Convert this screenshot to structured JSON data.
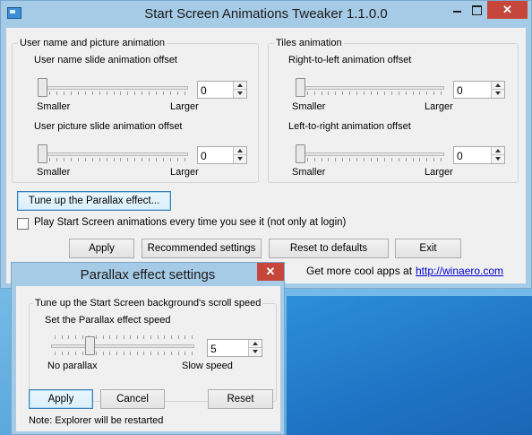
{
  "main_window": {
    "title": "Start Screen Animations Tweaker 1.1.0.0",
    "close_glyph": "✕",
    "user_group": {
      "legend": "User name and picture animation",
      "slide_label": "User name slide animation offset",
      "slide_value": "0",
      "picture_label": "User picture slide animation offset",
      "picture_value": "0",
      "min_label": "Smaller",
      "max_label": "Larger"
    },
    "tiles_group": {
      "legend": "Tiles animation",
      "rtl_label": "Right-to-left animation offset",
      "rtl_value": "0",
      "ltr_label": "Left-to-right animation offset",
      "ltr_value": "0",
      "min_label": "Smaller",
      "max_label": "Larger"
    },
    "parallax_button": "Tune up the Parallax effect...",
    "play_checkbox_label": "Play Start Screen animations every time you see it (not only at login)",
    "play_checkbox_checked": false,
    "buttons": {
      "apply": "Apply",
      "recommended": "Recommended settings",
      "reset_defaults": "Reset to defaults",
      "exit": "Exit"
    },
    "footer_text": "Get more cool apps at",
    "footer_link": "http://winaero.com"
  },
  "parallax_dialog": {
    "title": "Parallax effect settings",
    "close_glyph": "✕",
    "group_legend": "Tune up the Start Screen background's scroll speed",
    "speed_label": "Set the Parallax effect speed",
    "speed_value": "5",
    "min_label": "No parallax",
    "max_label": "Slow speed",
    "slider_level": 5,
    "buttons": {
      "apply": "Apply",
      "cancel": "Cancel",
      "reset": "Reset"
    },
    "note": "Note: Explorer will be restarted"
  },
  "colors": {
    "window_frame": "#a6cbe7",
    "close_button": "#c7463b",
    "link": "#0000cc"
  }
}
